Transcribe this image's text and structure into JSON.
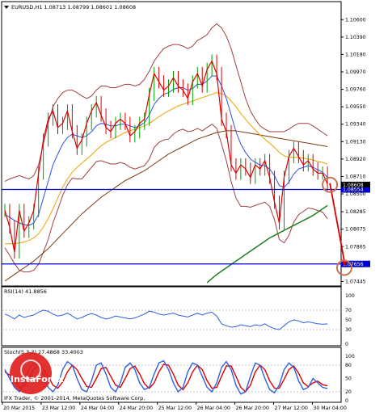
{
  "chart_data": {
    "type": "line",
    "symbol": "EURUSD,H1",
    "title": "EURUSD,H1  1.08713 1.08799 1.08601 1.08608",
    "last_price": "1.08608",
    "ylim": [
      1.0741,
      1.107
    ],
    "y_ticks": [
      "1.10600",
      "1.10390",
      "1.10180",
      "1.09970",
      "1.09760",
      "1.09550",
      "1.09340",
      "1.09130",
      "1.08920",
      "1.08710",
      "1.08500",
      "1.08285",
      "1.08075",
      "1.07865",
      "1.07445"
    ],
    "x_ticks": [
      "20 Mar 2015",
      "23 Mar 12:00",
      "24 Mar 04:00",
      "24 Mar 20:00",
      "25 Mar 12:00",
      "26 Mar 04:00",
      "26 Mar 20:00",
      "27 Mar 12:00",
      "30 Mar 04:00"
    ],
    "x_count": 70,
    "levels": [
      {
        "name": "resistance",
        "value": 1.08554,
        "label": "1.08554",
        "color": "#0000cc"
      },
      {
        "name": "target",
        "value": 1.07656,
        "label": "1.07656",
        "color": "#0000cc"
      }
    ],
    "price_label": {
      "value": 1.08608,
      "label": "1.08608"
    },
    "forecast": {
      "from": [
        67.5,
        1.0863
      ],
      "to": [
        70.5,
        1.0763
      ],
      "color": "#dd0000"
    },
    "circles": [
      {
        "x": 67.5,
        "y": 1.0861,
        "color": "#c87050"
      },
      {
        "x": 70.5,
        "y": 1.0761,
        "color": "#c87050"
      }
    ],
    "series": [
      {
        "name": "price",
        "color": "#dd0000",
        "values": [
          1.083,
          1.081,
          1.078,
          1.083,
          1.0805,
          1.0815,
          1.083,
          1.0875,
          1.0915,
          1.094,
          1.095,
          1.093,
          1.0935,
          1.095,
          1.0925,
          1.0905,
          1.0915,
          1.0935,
          1.095,
          1.096,
          1.0945,
          1.093,
          1.0925,
          1.0935,
          1.094,
          1.0935,
          1.092,
          1.0925,
          1.0935,
          1.094,
          1.097,
          1.0995,
          1.0985,
          1.0975,
          1.098,
          1.099,
          1.098,
          1.0975,
          1.0965,
          1.0985,
          1.0995,
          1.098,
          1.1,
          1.101,
          1.0995,
          1.094,
          1.0925,
          1.0885,
          1.0875,
          1.0885,
          1.088,
          1.087,
          1.0885,
          1.088,
          1.089,
          1.087,
          1.084,
          1.0815,
          1.087,
          1.0895,
          1.0905,
          1.0895,
          1.0885,
          1.089,
          1.088,
          1.0875,
          1.0875,
          1.0862
        ]
      },
      {
        "name": "ma_fast",
        "color": "#3050e0",
        "values": [
          1.0825,
          1.0822,
          1.0818,
          1.0815,
          1.0813,
          1.0812,
          1.0815,
          1.0825,
          1.0845,
          1.0865,
          1.0885,
          1.0898,
          1.091,
          1.0918,
          1.0922,
          1.092,
          1.0918,
          1.092,
          1.0925,
          1.0932,
          1.0935,
          1.0934,
          1.0932,
          1.0932,
          1.0934,
          1.0934,
          1.0932,
          1.093,
          1.0932,
          1.0936,
          1.0945,
          1.0958,
          1.0965,
          1.097,
          1.0972,
          1.0976,
          1.0978,
          1.0978,
          1.0975,
          1.0977,
          1.0982,
          1.0982,
          1.0986,
          1.0992,
          1.0992,
          1.098,
          1.0965,
          1.0945,
          1.0925,
          1.091,
          1.09,
          1.0892,
          1.0888,
          1.0885,
          1.0884,
          1.088,
          1.0872,
          1.086,
          1.0858,
          1.0864,
          1.0874,
          1.088,
          1.0882,
          1.0884,
          1.0882,
          1.0879,
          1.0876,
          1.087
        ]
      },
      {
        "name": "ma_mid",
        "color": "#f0a000",
        "values": [
          1.079,
          1.079,
          1.079,
          1.0791,
          1.0792,
          1.0794,
          1.0797,
          1.0802,
          1.081,
          1.082,
          1.0832,
          1.0845,
          1.0858,
          1.0868,
          1.0876,
          1.0882,
          1.0887,
          1.0892,
          1.0897,
          1.0903,
          1.0908,
          1.0912,
          1.0915,
          1.0918,
          1.0921,
          1.0924,
          1.0926,
          1.0928,
          1.093,
          1.0932,
          1.0935,
          1.0939,
          1.0943,
          1.0947,
          1.095,
          1.0953,
          1.0956,
          1.0958,
          1.096,
          1.0962,
          1.0964,
          1.0966,
          1.0968,
          1.097,
          1.0972,
          1.0971,
          1.0968,
          1.0962,
          1.0955,
          1.0947,
          1.094,
          1.0933,
          1.0927,
          1.0921,
          1.0916,
          1.0911,
          1.0906,
          1.09,
          1.0896,
          1.0894,
          1.0894,
          1.0894,
          1.0893,
          1.0892,
          1.0891,
          1.0889,
          1.0888,
          1.0886
        ]
      },
      {
        "name": "ma_slow",
        "color": "#7a3b10",
        "values": [
          1.0745,
          1.0749,
          1.0753,
          1.0757,
          1.0761,
          1.0765,
          1.0769,
          1.0774,
          1.0779,
          1.0784,
          1.079,
          1.0796,
          1.0802,
          1.0808,
          1.0814,
          1.082,
          1.0826,
          1.0831,
          1.0836,
          1.0841,
          1.0846,
          1.085,
          1.0854,
          1.0858,
          1.0862,
          1.0866,
          1.0869,
          1.0872,
          1.0875,
          1.0878,
          1.0882,
          1.0886,
          1.089,
          1.0894,
          1.0898,
          1.0901,
          1.0904,
          1.0907,
          1.091,
          1.0913,
          1.0916,
          1.0918,
          1.092,
          1.0922,
          1.0924,
          1.0925,
          1.0926,
          1.0926,
          1.0926,
          1.0925,
          1.0924,
          1.0923,
          1.0922,
          1.0921,
          1.092,
          1.0919,
          1.0918,
          1.0917,
          1.0916,
          1.0915,
          1.0914,
          1.0913,
          1.0912,
          1.0911,
          1.091,
          1.0909,
          1.0908,
          1.0907
        ]
      },
      {
        "name": "ma_green",
        "color": "#208020",
        "values": [
          null,
          null,
          null,
          null,
          null,
          null,
          null,
          null,
          null,
          null,
          null,
          null,
          null,
          null,
          null,
          null,
          null,
          null,
          null,
          null,
          null,
          null,
          null,
          null,
          null,
          null,
          null,
          null,
          null,
          null,
          null,
          null,
          null,
          null,
          null,
          null,
          null,
          null,
          null,
          null,
          null,
          null,
          1.0743,
          1.0748,
          1.0753,
          1.0757,
          1.0761,
          1.0765,
          1.0769,
          1.0773,
          1.0777,
          1.0781,
          1.0785,
          1.0789,
          1.0793,
          1.0797,
          1.08,
          1.0803,
          1.0806,
          1.0809,
          1.0812,
          1.0815,
          1.0818,
          1.0821,
          1.0824,
          1.0828,
          1.0832,
          1.0836
        ]
      },
      {
        "name": "band_upper",
        "color": "#a04040",
        "values": [
          1.0865,
          1.0868,
          1.087,
          1.0872,
          1.087,
          1.0868,
          1.0872,
          1.0885,
          1.091,
          1.0935,
          1.0955,
          1.0965,
          1.0972,
          1.0975,
          1.0975,
          1.0972,
          1.0968,
          1.0965,
          1.0968,
          1.0975,
          1.098,
          1.098,
          1.0978,
          1.0978,
          1.098,
          1.0982,
          1.0982,
          1.098,
          1.0982,
          1.0988,
          1.0998,
          1.101,
          1.1018,
          1.1025,
          1.1028,
          1.103,
          1.103,
          1.1028,
          1.1025,
          1.1028,
          1.1035,
          1.1038,
          1.1042,
          1.105,
          1.1055,
          1.105,
          1.104,
          1.1025,
          1.1005,
          1.0985,
          1.0965,
          1.095,
          1.094,
          1.0932,
          1.0928,
          1.0925,
          1.0925,
          1.0925,
          1.0925,
          1.0928,
          1.0932,
          1.0935,
          1.0935,
          1.0935,
          1.0932,
          1.0928,
          1.0924,
          1.092
        ]
      },
      {
        "name": "band_lower",
        "color": "#a04040",
        "values": [
          1.0785,
          1.0776,
          1.0766,
          1.0758,
          1.0756,
          1.0756,
          1.0758,
          1.0765,
          1.078,
          1.0795,
          1.0815,
          1.0831,
          1.0848,
          1.0861,
          1.0869,
          1.0868,
          1.0868,
          1.0875,
          1.0882,
          1.0889,
          1.089,
          1.0888,
          1.0886,
          1.0886,
          1.0888,
          1.0886,
          1.0882,
          1.088,
          1.0882,
          1.0884,
          1.0892,
          1.0906,
          1.0912,
          1.0915,
          1.0916,
          1.0922,
          1.0926,
          1.0928,
          1.0925,
          1.0926,
          1.0929,
          1.0926,
          1.093,
          1.0934,
          1.0929,
          1.091,
          1.089,
          1.0865,
          1.0845,
          1.0835,
          1.0835,
          1.0834,
          1.0836,
          1.0838,
          1.084,
          1.0835,
          1.0819,
          1.0795,
          1.0791,
          1.08,
          1.0816,
          1.0825,
          1.0829,
          1.0833,
          1.0832,
          1.083,
          1.0828,
          1.082
        ]
      }
    ],
    "rsi": {
      "label": "RSI(14) 41.8856",
      "ylim": [
        0,
        100
      ],
      "ticks": [
        "100",
        "70",
        "50",
        "30",
        "0"
      ],
      "color": "#3060e0",
      "values": [
        62,
        58,
        52,
        60,
        55,
        58,
        60,
        66,
        70,
        68,
        62,
        58,
        60,
        64,
        58,
        52,
        55,
        60,
        63,
        60,
        55,
        52,
        54,
        58,
        56,
        54,
        52,
        54,
        58,
        62,
        68,
        66,
        62,
        60,
        62,
        64,
        60,
        58,
        56,
        60,
        64,
        60,
        64,
        66,
        58,
        42,
        38,
        35,
        36,
        40,
        38,
        36,
        40,
        38,
        42,
        36,
        32,
        30,
        38,
        46,
        50,
        48,
        44,
        46,
        44,
        42,
        41,
        41.9
      ]
    },
    "stoch": {
      "label": "Stoch(5,3,3) 27.4868 33.4003",
      "ylim": [
        0,
        100
      ],
      "ticks": [
        "100",
        "80",
        "50",
        "20",
        "0"
      ],
      "main_color": "#3060e0",
      "signal_color": "#dd0000",
      "main": [
        70,
        50,
        30,
        20,
        40,
        70,
        85,
        80,
        60,
        30,
        20,
        35,
        70,
        88,
        80,
        50,
        25,
        20,
        45,
        80,
        85,
        60,
        30,
        20,
        40,
        75,
        85,
        70,
        40,
        25,
        30,
        60,
        85,
        90,
        70,
        40,
        20,
        30,
        65,
        85,
        80,
        55,
        30,
        20,
        40,
        75,
        88,
        70,
        35,
        15,
        20,
        55,
        85,
        80,
        50,
        25,
        18,
        35,
        70,
        85,
        75,
        45,
        25,
        30,
        50,
        40,
        30,
        27.5
      ],
      "signal": [
        65,
        58,
        45,
        30,
        32,
        50,
        70,
        80,
        72,
        55,
        35,
        28,
        42,
        65,
        80,
        70,
        50,
        32,
        30,
        50,
        72,
        75,
        55,
        35,
        30,
        50,
        72,
        78,
        60,
        38,
        28,
        40,
        65,
        82,
        80,
        60,
        35,
        25,
        40,
        65,
        80,
        70,
        45,
        28,
        30,
        55,
        78,
        78,
        55,
        30,
        20,
        35,
        65,
        80,
        70,
        45,
        28,
        28,
        48,
        70,
        78,
        62,
        40,
        32,
        40,
        44,
        36,
        33.4
      ]
    },
    "watermark": {
      "brand": "InstaForex",
      "copyright": "IFX Trader, © 2001-2014, MetaQuotes Software Corp."
    }
  },
  "colors": {
    "background": "#ffffff",
    "frame": "#000000",
    "bullish_candle": "#00a000",
    "bearish_candle": "#dd0000",
    "level": "#0000cc",
    "logo_red": "#e02020"
  }
}
